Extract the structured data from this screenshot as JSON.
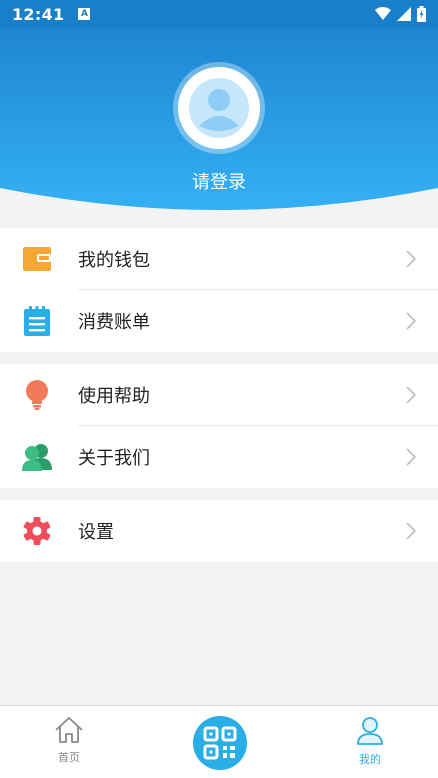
{
  "status_bar": {
    "time": "12:41",
    "notification_glyph": "A"
  },
  "header": {
    "login_label": "请登录",
    "colors": {
      "gradient_top": "#1a80cb",
      "gradient_bottom": "#2fa8f0"
    }
  },
  "menu": {
    "groups": [
      {
        "items": [
          {
            "label": "我的钱包",
            "icon": "wallet-icon",
            "color": "#f5a733"
          },
          {
            "label": "消费账单",
            "icon": "bill-icon",
            "color": "#2aaee6"
          }
        ]
      },
      {
        "items": [
          {
            "label": "使用帮助",
            "icon": "lightbulb-icon",
            "color": "#f07a5a"
          },
          {
            "label": "关于我们",
            "icon": "users-icon",
            "color": "#3bbd83"
          }
        ]
      },
      {
        "items": [
          {
            "label": "设置",
            "icon": "gear-icon",
            "color": "#ef4d5c"
          }
        ]
      }
    ]
  },
  "bottom_nav": {
    "home_label": "首页",
    "scan_icon": "qr-scan-icon",
    "mine_label": "我的",
    "colors": {
      "inactive": "#888888",
      "active": "#2aaee6"
    }
  }
}
